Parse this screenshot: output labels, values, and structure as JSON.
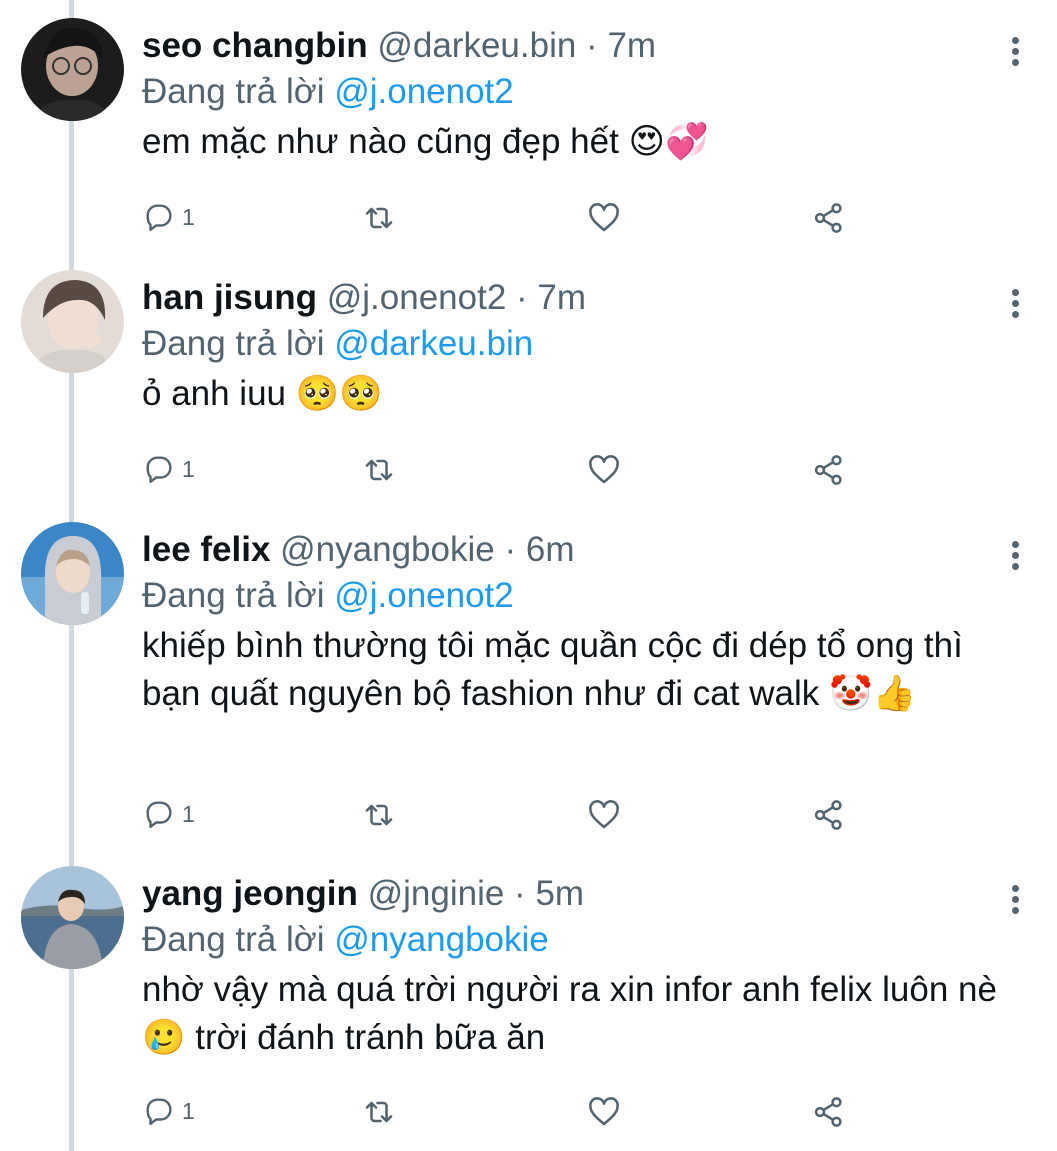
{
  "tweets": [
    {
      "name": "seo changbin",
      "handle": "@darkeu.bin",
      "dot": "·",
      "time": "7m",
      "reply_prefix": "Đang trả lời",
      "reply_to": "@j.onenot2",
      "text": "em mặc như nào cũng đẹp hết 😍💞",
      "reply_count": "1"
    },
    {
      "name": "han jisung",
      "handle": "@j.onenot2",
      "dot": "·",
      "time": "7m",
      "reply_prefix": "Đang trả lời",
      "reply_to": "@darkeu.bin",
      "text": "ỏ anh iuu 🥺🥺",
      "reply_count": "1"
    },
    {
      "name": "lee felix",
      "handle": "@nyangbokie",
      "dot": "·",
      "time": "6m",
      "reply_prefix": "Đang trả lời",
      "reply_to": "@j.onenot2",
      "text": "khiếp bình thường tôi mặc quần cộc đi dép tổ ong thì bạn quất nguyên bộ fashion như đi cat walk 🤡👍",
      "reply_count": "1"
    },
    {
      "name": "yang jeongin",
      "handle": "@jnginie",
      "dot": "·",
      "time": "5m",
      "reply_prefix": "Đang trả lời",
      "reply_to": "@nyangbokie",
      "text": "nhờ vậy mà quá trời người ra xin infor anh felix luôn nè 🥲 trời đánh tránh bữa ăn",
      "reply_count": "1"
    }
  ],
  "colors": {
    "text": "#0f1419",
    "muted": "#536471",
    "link": "#1d9bf0",
    "thread_line": "#cfd9de"
  },
  "icons": [
    "reply-icon",
    "retweet-icon",
    "like-icon",
    "share-icon",
    "more-icon"
  ]
}
